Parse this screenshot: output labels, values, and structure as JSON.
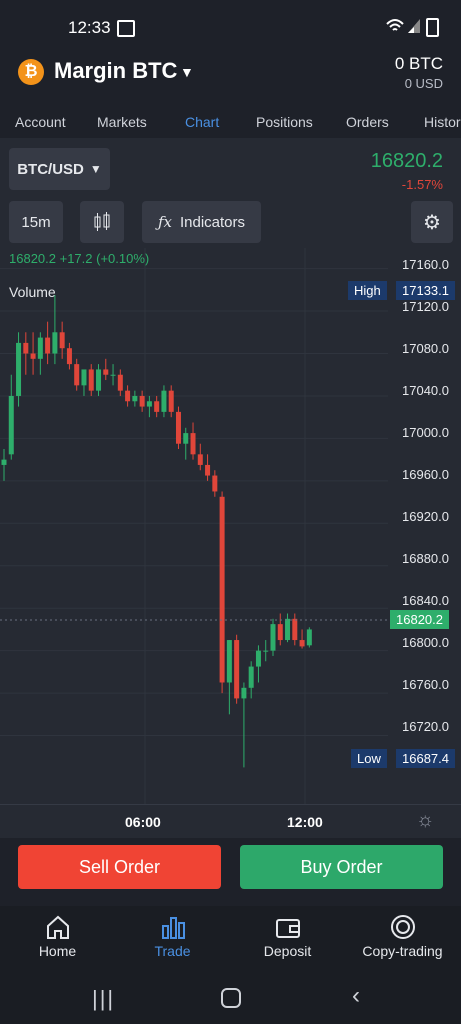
{
  "status": {
    "time": "12:33"
  },
  "header": {
    "title": "Margin BTC",
    "balance": "0 BTC",
    "balance_usd": "0 USD"
  },
  "tabs": [
    {
      "label": "Account"
    },
    {
      "label": "Markets"
    },
    {
      "label": "Chart"
    },
    {
      "label": "Positions"
    },
    {
      "label": "Orders"
    },
    {
      "label": "Histor"
    }
  ],
  "toolbar": {
    "pair": "BTC/USD",
    "price": "16820.2",
    "change_pct": "-1.57%",
    "interval": "15m",
    "indicators": "Indicators"
  },
  "ticker_line": "16820.2  +17.2 (+0.10%)",
  "volume_label": "Volume",
  "y_axis_labels": [
    "17160.0",
    "17120.0",
    "17080.0",
    "17040.0",
    "17000.0",
    "16960.0",
    "16920.0",
    "16880.0",
    "16840.0",
    "16800.0",
    "16760.0",
    "16720.0"
  ],
  "x_axis_labels": [
    "06:00",
    "12:00"
  ],
  "tags": {
    "high_label": "High",
    "high_value": "17133.1",
    "last_value": "16820.2",
    "low_label": "Low",
    "low_value": "16687.4"
  },
  "orders": {
    "sell": "Sell Order",
    "buy": "Buy Order"
  },
  "nav": [
    {
      "label": "Home"
    },
    {
      "label": "Trade"
    },
    {
      "label": "Deposit"
    },
    {
      "label": "Copy-trading"
    }
  ],
  "colors": {
    "up": "#2eae6b",
    "down": "#e0463a",
    "accent": "#4a90e2"
  },
  "chart_data": {
    "type": "candlestick",
    "ylim": [
      16680,
      17170
    ],
    "candles": [
      [
        16975,
        16990,
        16960,
        16980
      ],
      [
        16985,
        17060,
        16980,
        17040
      ],
      [
        17040,
        17100,
        17030,
        17090
      ],
      [
        17090,
        17100,
        17060,
        17080
      ],
      [
        17080,
        17100,
        17060,
        17075
      ],
      [
        17075,
        17100,
        17060,
        17095
      ],
      [
        17095,
        17110,
        17070,
        17080
      ],
      [
        17080,
        17135,
        17070,
        17100
      ],
      [
        17100,
        17110,
        17075,
        17085
      ],
      [
        17085,
        17090,
        17065,
        17070
      ],
      [
        17070,
        17075,
        17045,
        17050
      ],
      [
        17050,
        17060,
        17040,
        17065
      ],
      [
        17065,
        17070,
        17040,
        17045
      ],
      [
        17045,
        17070,
        17040,
        17065
      ],
      [
        17065,
        17075,
        17055,
        17060
      ],
      [
        17060,
        17070,
        17050,
        17060
      ],
      [
        17060,
        17065,
        17040,
        17045
      ],
      [
        17045,
        17050,
        17030,
        17035
      ],
      [
        17035,
        17045,
        17030,
        17040
      ],
      [
        17040,
        17045,
        17025,
        17030
      ],
      [
        17030,
        17040,
        17020,
        17035
      ],
      [
        17035,
        17040,
        17020,
        17025
      ],
      [
        17025,
        17050,
        17020,
        17045
      ],
      [
        17045,
        17050,
        17020,
        17025
      ],
      [
        17025,
        17030,
        16990,
        16995
      ],
      [
        16995,
        17010,
        16980,
        17005
      ],
      [
        17005,
        17015,
        16980,
        16985
      ],
      [
        16985,
        16995,
        16970,
        16975
      ],
      [
        16975,
        16985,
        16960,
        16965
      ],
      [
        16965,
        16970,
        16945,
        16950
      ],
      [
        16945,
        16950,
        16760,
        16770
      ],
      [
        16770,
        16810,
        16740,
        16810
      ],
      [
        16810,
        16815,
        16750,
        16755
      ],
      [
        16755,
        16770,
        16690,
        16765
      ],
      [
        16765,
        16790,
        16755,
        16785
      ],
      [
        16785,
        16805,
        16770,
        16800
      ],
      [
        16800,
        16810,
        16790,
        16800
      ],
      [
        16800,
        16830,
        16795,
        16825
      ],
      [
        16825,
        16835,
        16805,
        16810
      ],
      [
        16810,
        16835,
        16808,
        16830
      ],
      [
        16830,
        16835,
        16805,
        16810
      ],
      [
        16810,
        16820,
        16802,
        16804
      ],
      [
        16805,
        16822,
        16803,
        16820
      ]
    ]
  }
}
